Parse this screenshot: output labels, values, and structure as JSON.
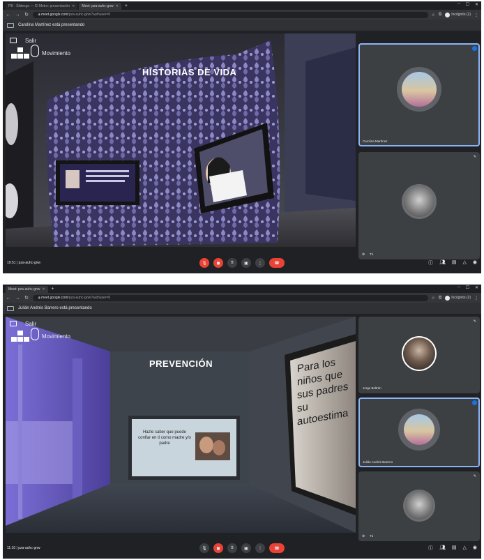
{
  "screens": [
    {
      "tabs": [
        {
          "label": "PB - Slidesgo — El Metro: presentación"
        },
        {
          "label": "Meet: pza-auhc-gnw"
        }
      ],
      "address": {
        "host": "meet.google.com",
        "path": "/pza-auhc-gnw?authuser=0"
      },
      "profile_label": "Incógnito (2)",
      "presenting_banner": "Carolina Martínez está presentando",
      "overlay": {
        "salir": "Salir",
        "movimiento": "Movimiento"
      },
      "stage_title": "HISTORIAS DE VIDA",
      "participants": [
        {
          "name": "Carolina Martínez",
          "active": true
        },
        {
          "name": "Tú",
          "active": false
        }
      ],
      "meeting_info": "10:51  |  pza-auhc-gnw"
    },
    {
      "tabs": [
        {
          "label": "Meet: pza-auhc-gnw"
        }
      ],
      "address": {
        "host": "meet.google.com",
        "path": "/pza-auhc-gnw?authuser=0"
      },
      "profile_label": "Incógnito (2)",
      "presenting_banner": "Julián Andrés Barrero está presentando",
      "overlay": {
        "salir": "Salir",
        "movimiento": "Movimiento"
      },
      "stage_title": "PREVENCIÓN",
      "poster_text": "Hazle saber que puede confiar en ti como madre y/o padre",
      "wall_text": "Para los niños que sus padres su autoestima",
      "participants": [
        {
          "name": "Jorge Beltrán",
          "active": false
        },
        {
          "name": "Julián Andrés Barrero",
          "active": true
        },
        {
          "name": "Tú",
          "active": false
        }
      ],
      "meeting_info": "11:10  |  pza-auhc-gnw"
    }
  ],
  "colors": {
    "meet_bg": "#202124",
    "tile_bg": "#3c4043",
    "danger": "#ea4335",
    "active_border": "#8ab4f8",
    "wallpaper": "#3a3560"
  },
  "icons": [
    "back-icon",
    "forward-icon",
    "reload-icon",
    "mic-off-icon",
    "camera-off-icon",
    "hand-icon",
    "present-icon",
    "more-icon",
    "hangup-icon",
    "info-icon",
    "people-icon",
    "chat-icon",
    "activities-icon",
    "lock-icon"
  ]
}
